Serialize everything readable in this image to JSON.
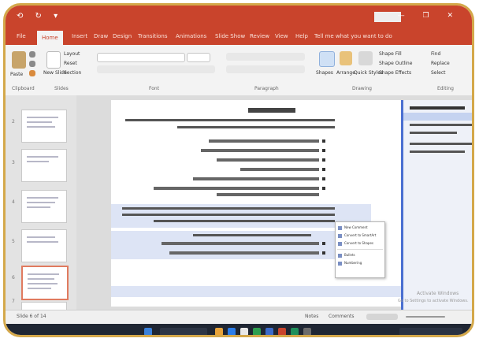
{
  "window": {
    "title": "",
    "signin_label": "",
    "quick_access": "⟲ ↻ ▾",
    "window_buttons": "— ❐ ✕"
  },
  "tabs": [
    {
      "label": "File"
    },
    {
      "label": "Home"
    },
    {
      "label": "Insert"
    },
    {
      "label": "Draw"
    },
    {
      "label": "Design"
    },
    {
      "label": "Transitions"
    },
    {
      "label": "Animations"
    },
    {
      "label": "Slide Show"
    },
    {
      "label": "Review"
    },
    {
      "label": "View"
    },
    {
      "label": "Help"
    },
    {
      "label": "Tell me what you want to do"
    }
  ],
  "ribbon": {
    "groups": [
      {
        "label": "Clipboard"
      },
      {
        "label": "Slides"
      },
      {
        "label": "Font"
      },
      {
        "label": "Paragraph"
      },
      {
        "label": "Drawing"
      },
      {
        "label": "Editing"
      }
    ],
    "buttons": {
      "paste": "Paste",
      "new_slide": "New Slide",
      "layout": "Layout",
      "reset": "Reset",
      "section": "Section",
      "shapes": "Shapes",
      "arrange": "Arrange",
      "quick_styles": "Quick Styles",
      "shape_fill": "Shape Fill",
      "shape_outline": "Shape Outline",
      "shape_effects": "Shape Effects",
      "find": "Find",
      "replace": "Replace",
      "select": "Select"
    }
  },
  "slide_thumbnails": [
    {
      "number": "2"
    },
    {
      "number": "3"
    },
    {
      "number": "4"
    },
    {
      "number": "5"
    },
    {
      "number": "6"
    },
    {
      "number": "7"
    }
  ],
  "menu": {
    "items": [
      {
        "label": "New Comment"
      },
      {
        "label": "Convert to SmartArt"
      },
      {
        "label": "Convert to Shapes"
      },
      {
        "label": "Bullets"
      },
      {
        "label": "Numbering"
      }
    ]
  },
  "status": {
    "slide_info": "Slide 6 of 14",
    "language": "",
    "notes": "Notes",
    "comments": "Comments",
    "zoom": ""
  },
  "watermark": {
    "line1": "Activate Windows",
    "line2": "Go to Settings to activate Windows."
  },
  "colors": {
    "accent": "#c9442c",
    "frame": "#d4a84a",
    "selection": "#4a6fd1",
    "highlight": "#dde4f5"
  }
}
